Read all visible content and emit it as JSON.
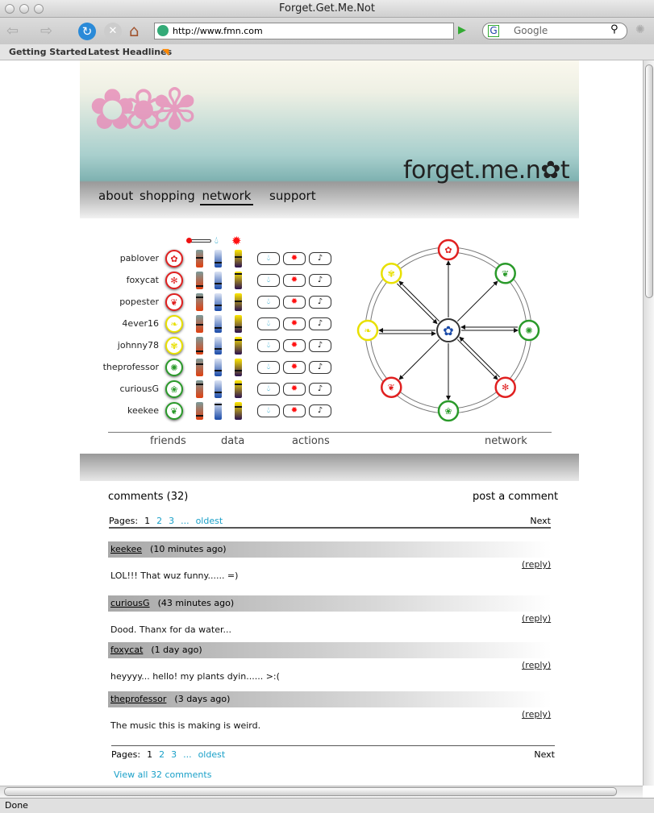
{
  "browser": {
    "title": "Forget.Get.Me.Not",
    "url": "http://www.fmn.com",
    "search_placeholder": "Google",
    "bookmarks": [
      "Getting Started",
      "Latest Headlines"
    ],
    "status": "Done"
  },
  "site": {
    "logo": "forget.me.n✿t",
    "nav": [
      {
        "label": "about"
      },
      {
        "label": "shopping"
      },
      {
        "label": "network",
        "active": true
      },
      {
        "label": "support"
      }
    ]
  },
  "colors": {
    "red": "#e02020",
    "yellow": "#e8e000",
    "green": "#2a9a2a",
    "link": "#1aa0c8"
  },
  "legend_icons": [
    "thermometer-icon",
    "water-drop-icon",
    "sun-icon"
  ],
  "friends": [
    {
      "name": "pablover",
      "status": "red",
      "flower": "✿",
      "temp": 0.55,
      "water": 0.25,
      "sun": 0.6
    },
    {
      "name": "foxycat",
      "status": "red",
      "flower": "✻",
      "temp": 0.15,
      "water": 0.3,
      "sun": 0.9
    },
    {
      "name": "popester",
      "status": "red",
      "flower": "❦",
      "temp": 0.8,
      "water": 0.3,
      "sun": 0.55
    },
    {
      "name": "4ever16",
      "status": "yellow",
      "flower": "❧",
      "temp": 0.45,
      "water": 0.25,
      "sun": 0.3
    },
    {
      "name": "johnny78",
      "status": "yellow",
      "flower": "✾",
      "temp": 0.15,
      "water": 0.3,
      "sun": 0.85
    },
    {
      "name": "theprofessor",
      "status": "green",
      "flower": "✺",
      "temp": 0.7,
      "water": 0.3,
      "sun": 0.3
    },
    {
      "name": "curiousG",
      "status": "green",
      "flower": "❀",
      "temp": 0.8,
      "water": 0.3,
      "sun": 0.8
    },
    {
      "name": "keekee",
      "status": "green",
      "flower": "❦",
      "temp": 0.2,
      "water": 0.9,
      "sun": 0.75
    }
  ],
  "actions": [
    "water",
    "sun",
    "music"
  ],
  "network_nodes": [
    {
      "status": "red",
      "flower": "✿"
    },
    {
      "status": "green",
      "flower": "❦"
    },
    {
      "status": "green",
      "flower": "✺"
    },
    {
      "status": "red",
      "flower": "✻"
    },
    {
      "status": "green",
      "flower": "❀"
    },
    {
      "status": "red",
      "flower": "❦"
    },
    {
      "status": "yellow",
      "flower": "❧"
    },
    {
      "status": "yellow",
      "flower": "✾"
    }
  ],
  "section_labels": {
    "friends": "friends",
    "data": "data",
    "actions": "actions",
    "network": "network"
  },
  "comments": {
    "title": "comments (32)",
    "post": "post a comment",
    "pages_label": "Pages:",
    "pages": [
      "1",
      "2",
      "3",
      "...",
      "oldest"
    ],
    "next": "Next",
    "view_all": "View all 32 comments",
    "reply": "(reply)",
    "items": [
      {
        "user": "keekee",
        "time": "(10 minutes ago)",
        "text": "LOL!!!  That wuz funny...... =)"
      },
      {
        "user": "curiousG",
        "time": "(43 minutes ago)",
        "text": "Dood. Thanx for da water..."
      },
      {
        "user": "foxycat",
        "time": "(1 day ago)",
        "text": "heyyyy... hello!  my plants dyin...... >:("
      },
      {
        "user": "theprofessor",
        "time": "(3 days ago)",
        "text": "The music this is making is weird."
      }
    ]
  }
}
